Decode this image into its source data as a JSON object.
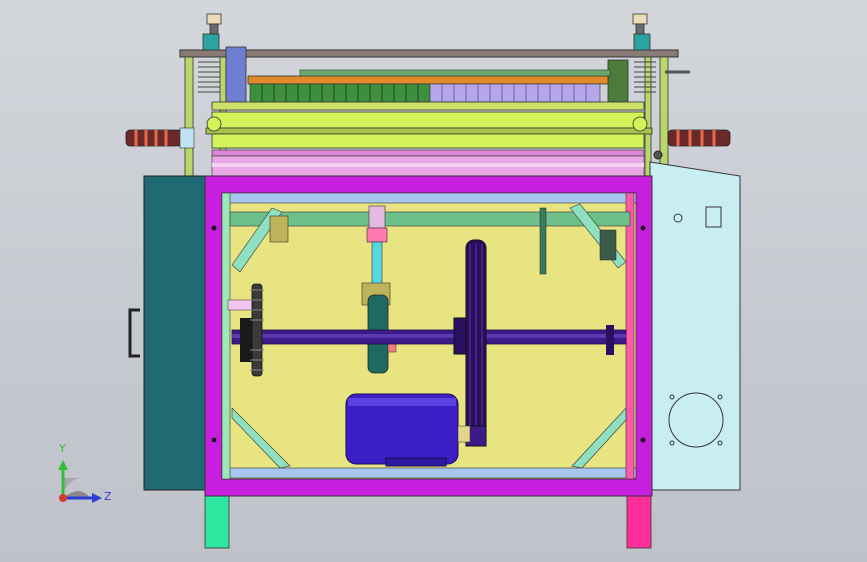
{
  "view": {
    "background_color": "#c9cdd2",
    "model_type": "cnc-cutting-machine-front-view",
    "triad": {
      "y_label": "Y",
      "z_label": "Z",
      "y_color": "#2fbf3a",
      "z_color": "#2a3fd6",
      "x_color": "#d63b2a"
    }
  },
  "colors": {
    "cabinet_side": "#1f6a73",
    "frame_magenta": "#c81ee0",
    "panel_yellow": "#e8e482",
    "side_panel": "#c8eef3",
    "roller_lime": "#d6f25a",
    "shaft": "#3d1a8a",
    "motor": "#3c1fc4",
    "leg_left": "#2ee6a0",
    "leg_right": "#ff2e9a"
  }
}
